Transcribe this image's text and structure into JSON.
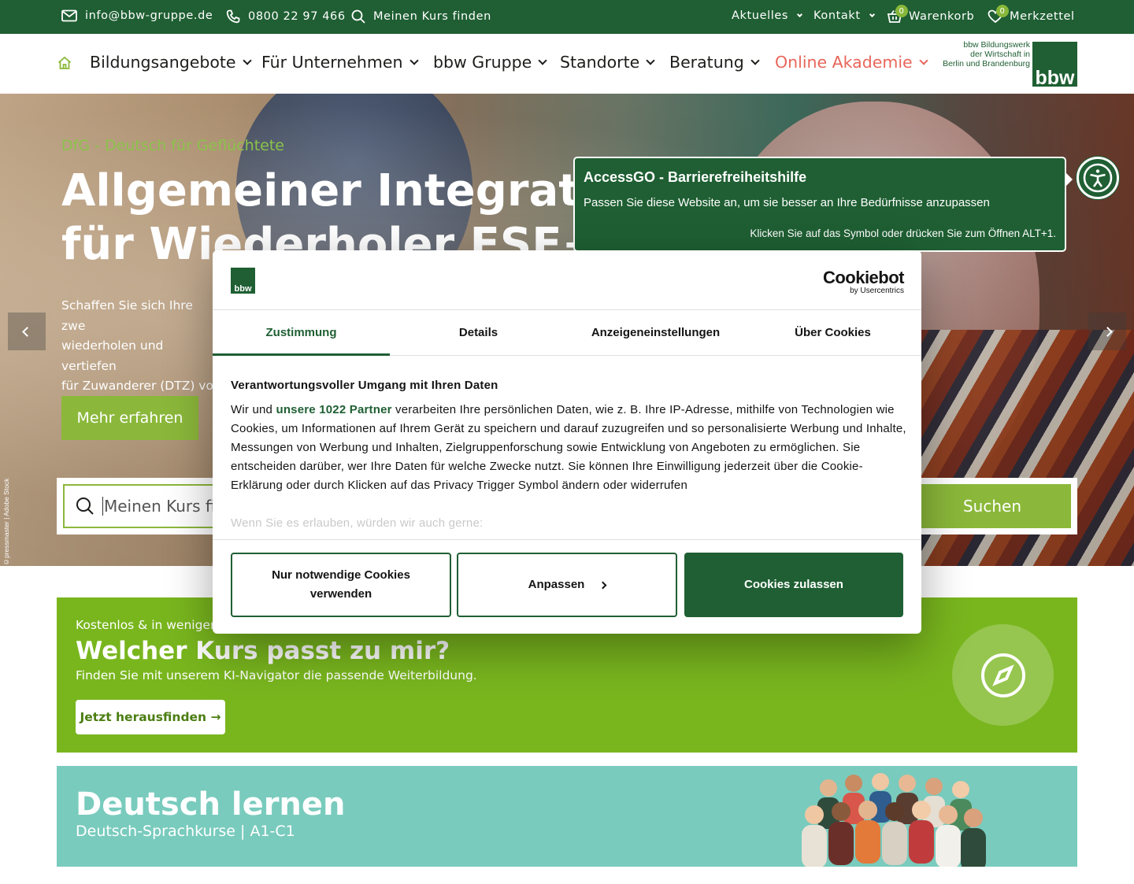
{
  "topbar": {
    "email": "info@bbw-gruppe.de",
    "phone": "0800 22 97 466",
    "find_course": "Meinen Kurs finden",
    "news": "Aktuelles",
    "contact": "Kontakt",
    "cart_label": "Warenkorb",
    "cart_count": "0",
    "watchlist_label": "Merkzettel",
    "watchlist_count": "0"
  },
  "nav": {
    "items": [
      "Bildungsangebote",
      "Für Unternehmen",
      "bbw Gruppe",
      "Standorte",
      "Beratung",
      "Online Akademie"
    ],
    "highlight_color": "#e8665a"
  },
  "logo": {
    "text_line1": "bbw Bildungswerk",
    "text_line2": "der Wirtschaft in",
    "text_line3": "Berlin und Brandenburg",
    "mark": "bbw"
  },
  "hero": {
    "kicker": "DfG - Deutsch für Geflüchtete",
    "title_line1": "Allgemeiner Integration",
    "title_line2": "für Wiederholer ESF+",
    "text_line1": "Schaffen Sie sich Ihre zwe",
    "text_line2": "wiederholen und vertiefen",
    "text_line3": "für Zuwanderer (DTZ) vor",
    "button": "Mehr erfahren",
    "credit": "©pressmaster | Adobe Stock"
  },
  "search": {
    "placeholder": "Meinen Kurs fin",
    "button": "Suchen"
  },
  "course_finder": {
    "kicker": "Kostenlos & in wenigen",
    "title": "Welcher Kurs passt zu mir?",
    "text": "Finden Sie mit unserem KI-Navigator die passende Weiterbildung.",
    "button": "Jetzt herausfinden →"
  },
  "german": {
    "title": "Deutsch lernen",
    "subtitle": "Deutsch-Sprachkurse | A1-C1"
  },
  "cookie": {
    "logo_mark": "bbw",
    "brand": "Cookiebot",
    "brand_sub": "by Usercentrics",
    "tabs": [
      "Zustimmung",
      "Details",
      "Anzeigeneinstellungen",
      "Über Cookies"
    ],
    "heading": "Verantwortungsvoller Umgang mit Ihren Daten",
    "body_prefix": "Wir und ",
    "partners_link": "unsere 1022 Partner",
    "body_rest": " verarbeiten Ihre persönlichen Daten, wie z. B. Ihre IP-Adresse, mithilfe von Technologien wie Cookies, um Informationen auf Ihrem Gerät zu speichern und darauf zuzugreifen und so personalisierte Werbung und Inhalte, Messungen von Werbung und Inhalten, Zielgruppenforschung sowie Entwicklung von Angeboten zu ermöglichen. Sie entscheiden darüber, wer Ihre Daten für welche Zwecke nutzt. Sie können Ihre Einwilligung jederzeit über die Cookie-Erklärung oder durch Klicken auf das Privacy Trigger Symbol ändern oder widerrufen",
    "faded": "Wenn Sie es erlauben, würden wir auch gerne:",
    "btn_necessary": "Nur notwendige Cookies verwenden",
    "btn_customize": "Anpassen",
    "btn_allow": "Cookies zulassen"
  },
  "accessgo": {
    "title": "AccessGO - Barrierefreiheitshilfe",
    "text": "Passen Sie diese Website an, um sie besser an Ihre Bedürfnisse anzupassen",
    "hint": "Klicken Sie auf das Symbol oder drücken Sie zum Öffnen ALT+1."
  },
  "colors": {
    "brand_green": "#1f5f33",
    "accent_green": "#8bb83a",
    "course_green": "#79b61e",
    "teal": "#79cbbd"
  }
}
